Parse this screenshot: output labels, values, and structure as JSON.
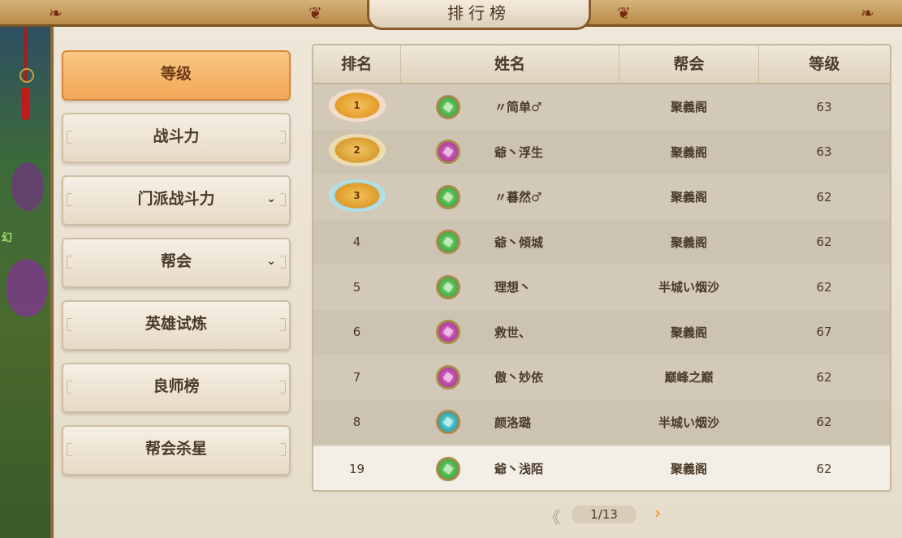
{
  "window": {
    "title": "排行榜"
  },
  "menu": [
    {
      "label": "等级",
      "active": true,
      "has_dropdown": false
    },
    {
      "label": "战斗力",
      "active": false,
      "has_dropdown": false
    },
    {
      "label": "门派战斗力",
      "active": false,
      "has_dropdown": true
    },
    {
      "label": "帮会",
      "active": false,
      "has_dropdown": true
    },
    {
      "label": "英雄试炼",
      "active": false,
      "has_dropdown": false
    },
    {
      "label": "良师榜",
      "active": false,
      "has_dropdown": false
    },
    {
      "label": "帮会杀星",
      "active": false,
      "has_dropdown": false
    }
  ],
  "table": {
    "headers": [
      "排名",
      "姓名",
      "帮会",
      "等级"
    ],
    "rows": [
      {
        "rank": "1",
        "medal": "gold",
        "avatar": "green",
        "name": "〃简单♂",
        "guild": "聚義阁",
        "level": "63"
      },
      {
        "rank": "2",
        "medal": "silver",
        "avatar": "purple",
        "name": "爺丶浮生",
        "guild": "聚義阁",
        "level": "63"
      },
      {
        "rank": "3",
        "medal": "bronze",
        "avatar": "green",
        "name": "〃暮然♂",
        "guild": "聚義阁",
        "level": "62"
      },
      {
        "rank": "4",
        "medal": "",
        "avatar": "green",
        "name": "爺丶傾城",
        "guild": "聚義阁",
        "level": "62"
      },
      {
        "rank": "5",
        "medal": "",
        "avatar": "green",
        "name": "理想丶",
        "guild": "半城い烟沙",
        "level": "62"
      },
      {
        "rank": "6",
        "medal": "",
        "avatar": "purple",
        "name": "救世、",
        "guild": "聚義阁",
        "level": "67"
      },
      {
        "rank": "7",
        "medal": "",
        "avatar": "purple",
        "name": "傲丶妙依",
        "guild": "巅峰之巅",
        "level": "62"
      },
      {
        "rank": "8",
        "medal": "",
        "avatar": "teal",
        "name": "颜洛璐",
        "guild": "半城い烟沙",
        "level": "62"
      }
    ],
    "my_row": {
      "rank": "19",
      "avatar": "green",
      "name": "爺丶浅陌",
      "guild": "聚義阁",
      "level": "62"
    }
  },
  "pager": {
    "prev": "《",
    "current": "1/13",
    "next": "›"
  }
}
